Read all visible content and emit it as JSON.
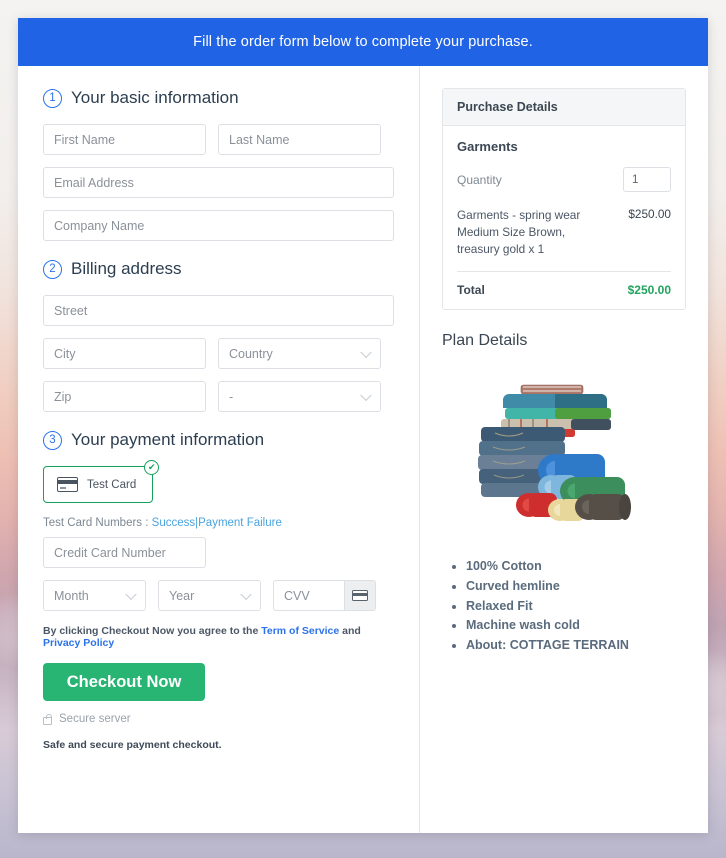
{
  "banner": {
    "text": "Fill the order form below to complete your purchase."
  },
  "sections": {
    "basic": {
      "number": "1",
      "title": "Your basic information",
      "fields": {
        "first_name": "First Name",
        "last_name": "Last Name",
        "email": "Email Address",
        "company": "Company Name"
      }
    },
    "billing": {
      "number": "2",
      "title": "Billing address",
      "fields": {
        "street": "Street",
        "city": "City",
        "country": "Country",
        "zip": "Zip",
        "state": "-"
      }
    },
    "payment": {
      "number": "3",
      "title": "Your payment information",
      "method_tile": {
        "label": "Test Card",
        "icon": "credit-card-icon",
        "selected_check": "✔"
      },
      "test_numbers": {
        "prefix": "Test Card Numbers :",
        "success_link": "Success",
        "separator": "|",
        "failure_link": "Payment Failure"
      },
      "fields": {
        "card_number": "Credit Card Number",
        "month": "Month",
        "year": "Year",
        "cvv": "CVV"
      }
    }
  },
  "terms": {
    "prefix": "By clicking Checkout Now you agree to the",
    "tos_link": "Term of Service",
    "conjunction": "and",
    "privacy_link": "Privacy Policy"
  },
  "checkout": {
    "button_label": "Checkout Now",
    "secure_label": "Secure server",
    "safe_note": "Safe and secure payment checkout."
  },
  "purchase_details": {
    "header": "Purchase Details",
    "product_title": "Garments",
    "quantity_label": "Quantity",
    "quantity_value": "1",
    "line_item": {
      "description": "Garments - spring wear Medium Size Brown, treasury gold x 1",
      "price": "$250.00"
    },
    "total_label": "Total",
    "total_value": "$250.00"
  },
  "plan_details": {
    "title": "Plan Details",
    "image_alt": "stack-of-folded-garments",
    "features": [
      "100% Cotton",
      "Curved hemline",
      "Relaxed Fit",
      "Machine wash cold",
      "About: COTTAGE TERRAIN"
    ]
  },
  "colors": {
    "banner_blue": "#2063e4",
    "checkout_green": "#28b473",
    "total_green": "#22a35e",
    "step_blue": "#2b72e8",
    "link_blue": "#2b72e8",
    "test_link_blue": "#4ba3dd",
    "tile_border_green": "#15a05c"
  }
}
